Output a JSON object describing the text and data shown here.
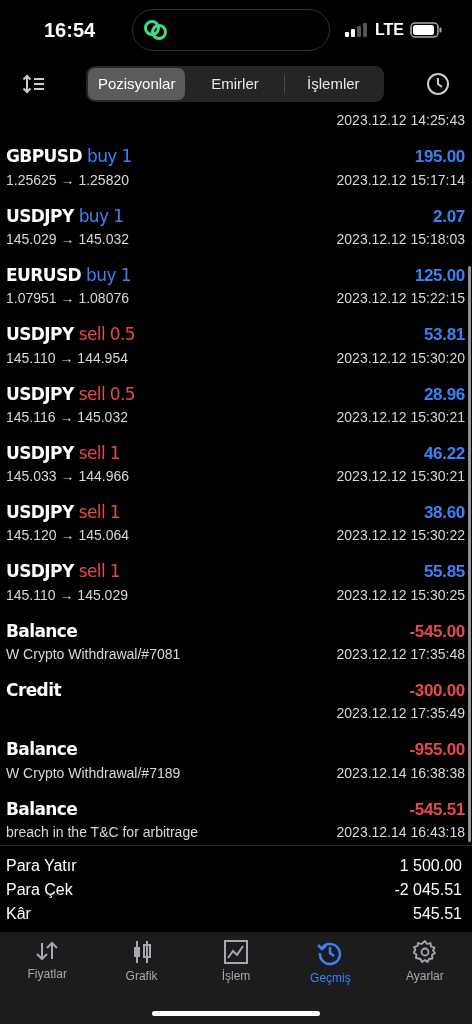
{
  "status_bar": {
    "time": "16:54",
    "network": "LTE"
  },
  "tabs": [
    {
      "label": "Pozisyonlar",
      "selected": true
    },
    {
      "label": "Emirler",
      "selected": false
    },
    {
      "label": "İşlemler",
      "selected": false
    }
  ],
  "partial_row": {
    "time": "2023.12.12 14:25:43"
  },
  "rows": [
    {
      "kind": "buy",
      "symbol": "GBPUSD",
      "volume": "buy 1",
      "prices": "1.25625 → 1.25820",
      "amount": "195.00",
      "negative": false,
      "time": "2023.12.12 15:17:14"
    },
    {
      "kind": "buy",
      "symbol": "USDJPY",
      "volume": "buy 1",
      "prices": "145.029 → 145.032",
      "amount": "2.07",
      "negative": false,
      "time": "2023.12.12 15:18:03"
    },
    {
      "kind": "buy",
      "symbol": "EURUSD",
      "volume": "buy 1",
      "prices": "1.07951 → 1.08076",
      "amount": "125.00",
      "negative": false,
      "time": "2023.12.12 15:22:15"
    },
    {
      "kind": "sell",
      "symbol": "USDJPY",
      "volume": "sell 0.5",
      "prices": "145.110 → 144.954",
      "amount": "53.81",
      "negative": false,
      "time": "2023.12.12 15:30:20"
    },
    {
      "kind": "sell",
      "symbol": "USDJPY",
      "volume": "sell 0.5",
      "prices": "145.116 → 145.032",
      "amount": "28.96",
      "negative": false,
      "time": "2023.12.12 15:30:21"
    },
    {
      "kind": "sell",
      "symbol": "USDJPY",
      "volume": "sell 1",
      "prices": "145.033 → 144.966",
      "amount": "46.22",
      "negative": false,
      "time": "2023.12.12 15:30:21"
    },
    {
      "kind": "sell",
      "symbol": "USDJPY",
      "volume": "sell 1",
      "prices": "145.120 → 145.064",
      "amount": "38.60",
      "negative": false,
      "time": "2023.12.12 15:30:22"
    },
    {
      "kind": "sell",
      "symbol": "USDJPY",
      "volume": "sell 1",
      "prices": "145.110 → 145.029",
      "amount": "55.85",
      "negative": false,
      "time": "2023.12.12 15:30:25"
    },
    {
      "kind": "balance",
      "symbol": "Balance",
      "comment": "W Crypto Withdrawal/#7081",
      "amount": "-545.00",
      "negative": true,
      "time": "2023.12.12 17:35:48"
    },
    {
      "kind": "balance",
      "symbol": "Credit",
      "amount": "-300.00",
      "negative": true,
      "time": "2023.12.12 17:35:49"
    },
    {
      "kind": "balance",
      "symbol": "Balance",
      "comment": "W Crypto Withdrawal/#7189",
      "amount": "-955.00",
      "negative": true,
      "time": "2023.12.14 16:38:38"
    },
    {
      "kind": "balance",
      "symbol": "Balance",
      "comment": "breach in the T&C for arbitrage",
      "amount": "-545.51",
      "negative": true,
      "time": "2023.12.14 16:43:18"
    }
  ],
  "summary": [
    {
      "label": "Para Yatır",
      "value": "1 500.00"
    },
    {
      "label": "Para Çek",
      "value": "-2 045.51"
    },
    {
      "label": "Kâr",
      "value": "545.51"
    }
  ],
  "bottom_nav": [
    {
      "label": "Fiyatlar",
      "selected": false
    },
    {
      "label": "Grafik",
      "selected": false
    },
    {
      "label": "İşlem",
      "selected": false
    },
    {
      "label": "Geçmiş",
      "selected": true
    },
    {
      "label": "Ayarlar",
      "selected": false
    }
  ]
}
